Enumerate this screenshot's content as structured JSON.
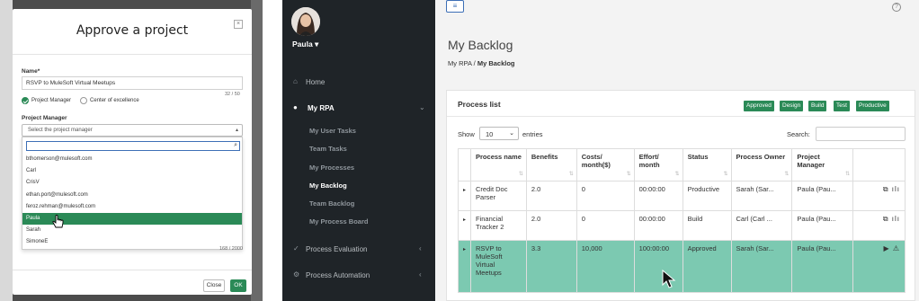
{
  "modal": {
    "title": "Approve a project",
    "close_icon": "×",
    "name_label": "Name*",
    "name_value": "RSVP to MuleSoft Virtual Meetups",
    "name_counter": "32 / 50",
    "radio_project_manager": "Project Manager",
    "radio_center_of_excellence": "Center of excellence",
    "pm_label": "Project Manager",
    "pm_placeholder": "Select the project manager",
    "dropdown_items": [
      "bthomerson@mulesoft.com",
      "Carl",
      "CrisV",
      "ethan.port@mulesoft.com",
      "feroz.rehman@mulesoft.com",
      "Paula",
      "Sarah",
      "SimoneE"
    ],
    "selected_item": "Paula",
    "desc_counter": "168 / 2000",
    "close_button": "Close",
    "ok_button": "OK"
  },
  "sidebar": {
    "user": "Paula ▾",
    "home": "Home",
    "my_rpa": "My RPA",
    "sub_items": [
      "My User Tasks",
      "Team Tasks",
      "My Processes",
      "My Backlog",
      "Team Backlog",
      "My Process Board"
    ],
    "process_evaluation": "Process Evaluation",
    "process_automation": "Process Automation"
  },
  "main": {
    "help": "?",
    "title": "My Backlog",
    "breadcrumb_root": "My RPA",
    "breadcrumb_sep": "/",
    "breadcrumb_current": "My Backlog",
    "card_title": "Process list",
    "tags": [
      "Approved",
      "Design",
      "Build",
      "Test",
      "Productive"
    ],
    "show_label": "Show",
    "show_value": "10",
    "entries_label": "entries",
    "search_label": "Search:",
    "columns": [
      "Process name",
      "Benefits",
      "Costs/ month($)",
      "Effort/ month",
      "Status",
      "Process Owner",
      "Project Manager"
    ],
    "rows": [
      {
        "name": "Credit Doc Parser",
        "benefits": "2.0",
        "costs": "0",
        "effort": "00:00:00",
        "status": "Productive",
        "owner": "Sarah (Sar...",
        "manager": "Paula (Pau...",
        "actions": "⧉ ılı"
      },
      {
        "name": "Financial Tracker 2",
        "benefits": "2.0",
        "costs": "0",
        "effort": "00:00:00",
        "status": "Build",
        "owner": "Carl (Carl ...",
        "manager": "Paula (Pau...",
        "actions": "⧉ ılı"
      },
      {
        "name": "RSVP to MuleSoft Virtual Meetups",
        "benefits": "3.3",
        "costs": "10,000",
        "effort": "100:00:00",
        "status": "Approved",
        "owner": "Sarah (Sar...",
        "manager": "Paula (Pau...",
        "actions": "▶ ⚠"
      }
    ]
  },
  "colors": {
    "accent_green": "#2b8a57",
    "highlight_row": "#7cc9b1",
    "sidebar_bg": "#1f2428"
  }
}
